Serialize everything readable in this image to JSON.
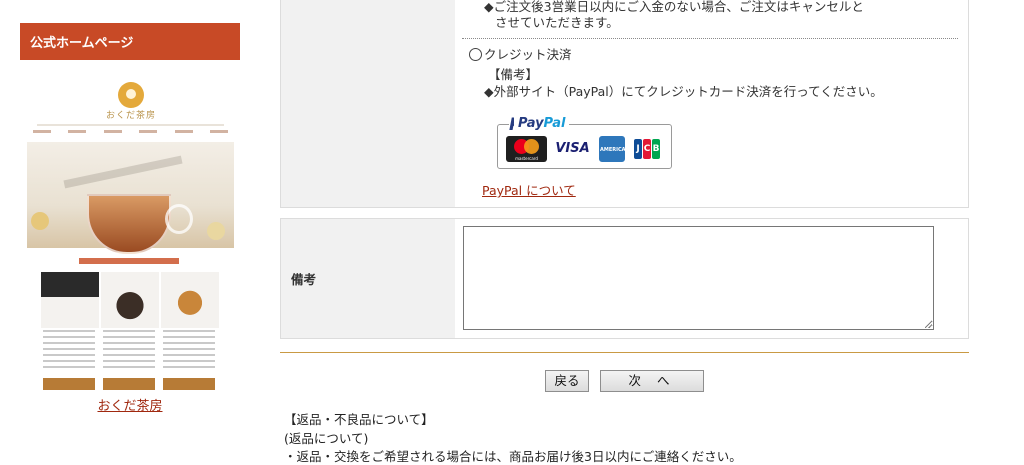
{
  "sidebar": {
    "heading": "公式ホームページ",
    "link_label": "おくだ茶房",
    "brand_colors": {
      "header_bg": "#c84a26",
      "link": "#a0280f"
    }
  },
  "payment": {
    "cancel_notice_line1": "◆ご注文後3営業日以内にご入金のない場合、ご注文はキャンセルと",
    "cancel_notice_line2": "させていただきます。",
    "credit_label": "クレジット決済",
    "remarks_heading": "【備考】",
    "remarks_text": "◆外部サイト（PayPal）にてクレジットカード決済を行ってください。",
    "paypal_logo_text_1": "Pay",
    "paypal_logo_text_2": "Pal",
    "card_brands": [
      "mastercard",
      "VISA",
      "AMERICAN EXPRESS",
      "JCB"
    ],
    "paypal_about_link": "PayPal について"
  },
  "notes": {
    "label": "備考",
    "value": ""
  },
  "buttons": {
    "back": "戻る",
    "next": "次 へ"
  },
  "footer": {
    "returns_heading": "【返品・不良品について】",
    "returns_sub": "(返品について)",
    "returns_text": "・返品・交換をご希望される場合には、商品お届け後3日以内にご連絡ください。"
  }
}
